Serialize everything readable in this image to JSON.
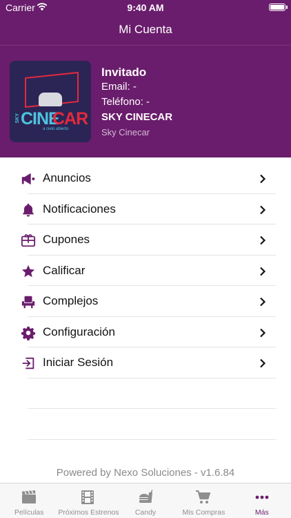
{
  "status_bar": {
    "carrier": "Carrier",
    "time": "9:40 AM"
  },
  "nav": {
    "title": "Mi Cuenta"
  },
  "colors": {
    "primary": "#6a1d6c",
    "header_bg": "#6a1d6c",
    "tab_inactive": "#8e8e8e"
  },
  "logo": {
    "brand_prefix": "SKY",
    "brand_cine": "CINE",
    "brand_car": "CAR",
    "tagline": "a cielo abierto"
  },
  "profile": {
    "name": "Invitado",
    "email": "Email: -",
    "phone": "Teléfono: -",
    "cinema": "SKY CINECAR",
    "cinema_sub": "Sky Cinecar"
  },
  "menu": {
    "items": [
      {
        "label": "Anuncios",
        "icon": "megaphone-icon"
      },
      {
        "label": "Notificaciones",
        "icon": "bell-icon"
      },
      {
        "label": "Cupones",
        "icon": "gift-card-icon"
      },
      {
        "label": "Calificar",
        "icon": "star-icon"
      },
      {
        "label": "Complejos",
        "icon": "seat-icon"
      },
      {
        "label": "Configuración",
        "icon": "gear-icon"
      },
      {
        "label": "Iniciar Sesión",
        "icon": "login-icon"
      }
    ]
  },
  "footer": {
    "text": "Powered by Nexo Soluciones - v1.6.84"
  },
  "tabbar": {
    "tabs": [
      {
        "label": "Películas",
        "icon": "clapperboard-icon"
      },
      {
        "label": "Próximos Estrenos",
        "icon": "film-strip-icon"
      },
      {
        "label": "Candy",
        "icon": "food-icon"
      },
      {
        "label": "Mis Compras",
        "icon": "cart-icon"
      },
      {
        "label": "Más",
        "icon": "more-dots-icon"
      }
    ],
    "active_tab": "Más"
  }
}
